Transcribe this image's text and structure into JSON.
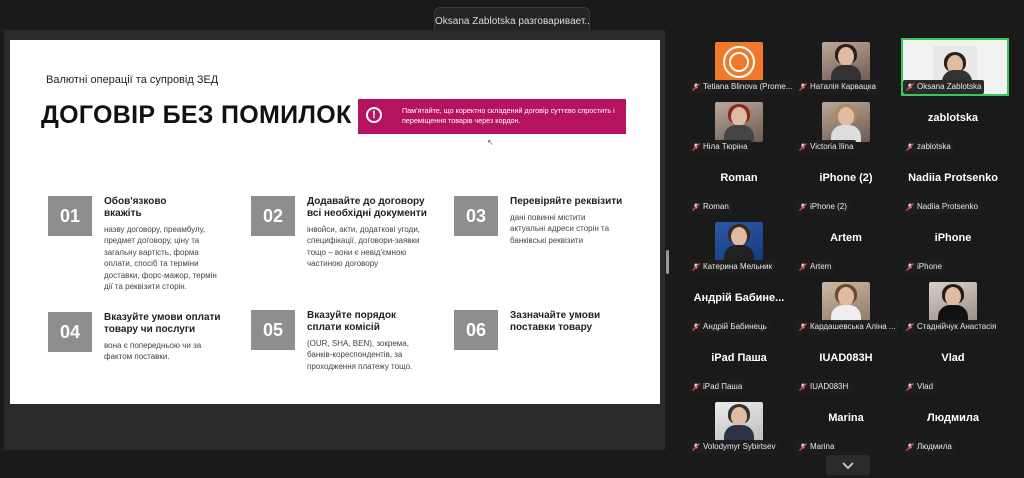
{
  "toast": {
    "text": "Oksana Zablotska разговаривает..."
  },
  "slide": {
    "course": "Валютні операції та супровід ЗЕД",
    "headline": "ДОГОВІР БЕЗ ПОМИЛОК",
    "note": "Пам'ятайте, що коректно складений договір суттєво спростить і переміщення товарів через кордон.",
    "steps": [
      {
        "num": "01",
        "title": "Обов'язково вкажіть",
        "desc": "назву договору, преамбулу, предмет договору, ціну та загальну вартість, форма оплати, спосіб та терміни доставки, форс-мажор, термін дії та реквізити сторін."
      },
      {
        "num": "02",
        "title": "Додавайте до договору всі необхідні документи",
        "desc": "інвойси, акти, додаткові угоди, специфікації, договори-заявки тощо – вони є невід'ємною частиною договору"
      },
      {
        "num": "03",
        "title": "Перевіряйте реквізити",
        "desc": "дані повинні містити актуальні адреси сторін та банківські реквізити"
      },
      {
        "num": "04",
        "title": "Вказуйте умови оплати товару чи послуги",
        "desc": "вона є попередньою чи за фактом поставки."
      },
      {
        "num": "05",
        "title": "Вказуйте порядок сплати комісій",
        "desc": "(OUR, SHA, BEN), зокрема, банків-кореспондентів, за проходження платежу тощо."
      },
      {
        "num": "06",
        "title": "Зазначайте умови поставки товару",
        "desc": ""
      }
    ]
  },
  "participants": [
    {
      "label": "Tetiana Blinova (Prome...",
      "big": ""
    },
    {
      "label": "Наталія Карвацка",
      "big": ""
    },
    {
      "label": "Oksana Zablotska",
      "big": ""
    },
    {
      "label": "Ніла Тюріна",
      "big": ""
    },
    {
      "label": "Victoria Ilina",
      "big": ""
    },
    {
      "label": "zablotska",
      "big": "zablotska"
    },
    {
      "label": "Roman",
      "big": "Roman"
    },
    {
      "label": "iPhone (2)",
      "big": "iPhone (2)"
    },
    {
      "label": "Nadiia Protsenko",
      "big": "Nadiia Protsenko"
    },
    {
      "label": "Катерина Мельник",
      "big": ""
    },
    {
      "label": "Artem",
      "big": "Artem"
    },
    {
      "label": "iPhone",
      "big": "iPhone"
    },
    {
      "label": "Андрій Бабинець",
      "big": "Андрій Бабине..."
    },
    {
      "label": "Кардашевська Аліна ...",
      "big": ""
    },
    {
      "label": "Стаднійчук Анастасія",
      "big": ""
    },
    {
      "label": "iPad Паша",
      "big": "iPad Паша"
    },
    {
      "label": "IUAD083H",
      "big": "IUAD083H"
    },
    {
      "label": "Vlad",
      "big": "Vlad"
    },
    {
      "label": "Volodymyr Sybirtsev",
      "big": ""
    },
    {
      "label": "Marina",
      "big": "Marina"
    },
    {
      "label": "Людмила",
      "big": "Людмила"
    }
  ],
  "colors": {
    "accent": "#b5135f",
    "active_speaker": "#38c75a",
    "muted_mic": "#e0434b"
  },
  "icons": {
    "muted": "mic-off-icon",
    "scroll": "chevron-down-icon",
    "alert": "alert-circle-icon"
  }
}
